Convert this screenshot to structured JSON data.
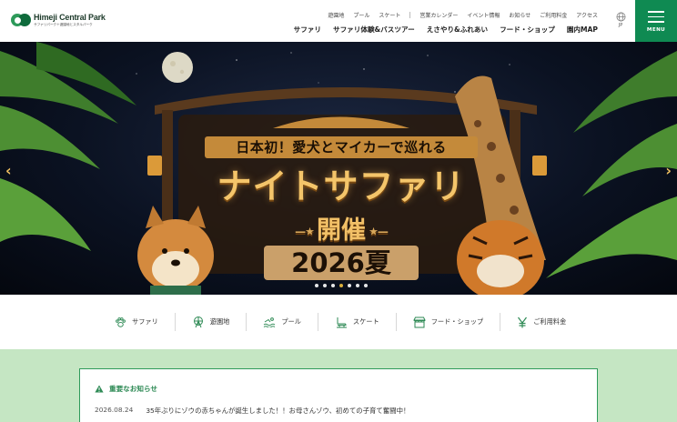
{
  "header": {
    "logo_name": "Himeji Central Park",
    "logo_sub": "サファリパーク＋遊園地とスタルパーク",
    "subnav_left": [
      "遊園地",
      "プール",
      "スケート"
    ],
    "subnav_right": [
      "営業カレンダー",
      "イベント情報",
      "お知らせ",
      "ご利用料金",
      "アクセス"
    ],
    "mainnav": [
      "サファリ",
      "サファリ体験&バスツアー",
      "えさやり&ふれあい",
      "フード・ショップ",
      "園内MAP"
    ],
    "lang": "JP",
    "menu_label": "MENU"
  },
  "hero": {
    "tagline": "日本初！愛犬とマイカーで巡れる",
    "title": "ナイトサファリ",
    "subtitle": "開催",
    "year": "2026夏",
    "prev_arrow": "‹",
    "next_arrow": "›",
    "slide_count": 7,
    "active_slide": 4
  },
  "quicknav": [
    {
      "label": "サファリ",
      "icon": "paw-icon"
    },
    {
      "label": "遊園地",
      "icon": "ferris-wheel-icon"
    },
    {
      "label": "プール",
      "icon": "swim-icon"
    },
    {
      "label": "スケート",
      "icon": "skate-icon"
    },
    {
      "label": "フード・ショップ",
      "icon": "shop-icon"
    },
    {
      "label": "ご利用料金",
      "icon": "yen-icon"
    }
  ],
  "news": {
    "heading": "重要なお知らせ",
    "items": [
      {
        "date": "2026.08.24",
        "text": "35年ぶりにゾウの赤ちゃんが誕生しました！！お母さんゾウ、初めての子育て奮闘中！"
      }
    ]
  },
  "colors": {
    "brand_green": "#0f8a52",
    "news_bg": "#c5e6c3",
    "accent_gold": "#f4c56a"
  }
}
